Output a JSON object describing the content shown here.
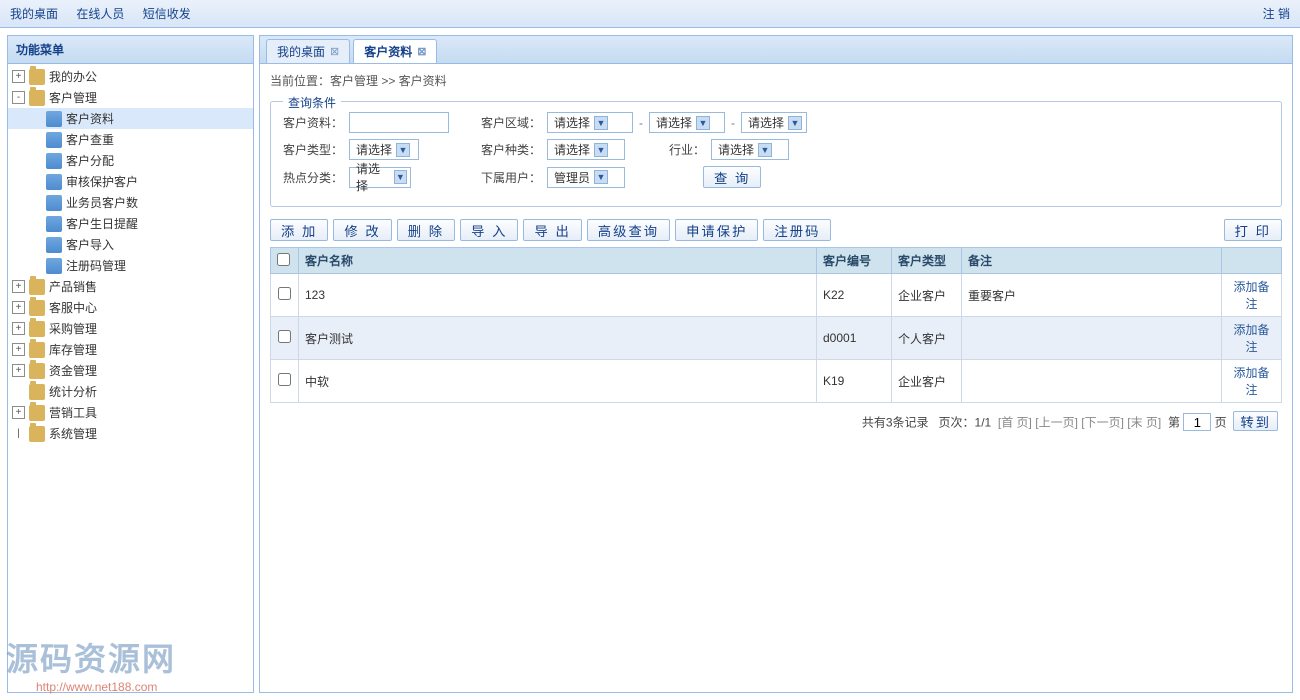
{
  "topbar": {
    "links": [
      "我的桌面",
      "在线人员",
      "短信收发"
    ],
    "logout": "注 销"
  },
  "sidebar": {
    "title": "功能菜单",
    "nodes": [
      {
        "label": "我的办公",
        "expand": "+",
        "level": 0
      },
      {
        "label": "客户管理",
        "expand": "-",
        "level": 0
      },
      {
        "label": "客户资料",
        "level": 1,
        "selected": true
      },
      {
        "label": "客户查重",
        "level": 1
      },
      {
        "label": "客户分配",
        "level": 1
      },
      {
        "label": "审核保护客户",
        "level": 1
      },
      {
        "label": "业务员客户数",
        "level": 1
      },
      {
        "label": "客户生日提醒",
        "level": 1
      },
      {
        "label": "客户导入",
        "level": 1
      },
      {
        "label": "注册码管理",
        "level": 1
      },
      {
        "label": "产品销售",
        "expand": "+",
        "level": 0
      },
      {
        "label": "客服中心",
        "expand": "+",
        "level": 0
      },
      {
        "label": "采购管理",
        "expand": "+",
        "level": 0
      },
      {
        "label": "库存管理",
        "expand": "+",
        "level": 0
      },
      {
        "label": "资金管理",
        "expand": "+",
        "level": 0
      },
      {
        "label": "统计分析",
        "expand": "",
        "level": 0,
        "noToggle": true
      },
      {
        "label": "营销工具",
        "expand": "+",
        "level": 0
      },
      {
        "label": "系统管理",
        "expand": "",
        "level": 0,
        "lastIcon": true
      }
    ]
  },
  "tabs": [
    {
      "label": "我的桌面",
      "active": false
    },
    {
      "label": "客户资料",
      "active": true
    }
  ],
  "breadcrumb": "当前位置：客户管理  >>  客户资料",
  "search": {
    "legend": "查询条件",
    "labels": {
      "customerData": "客户资料：",
      "customerArea": "客户区域：",
      "customerType": "客户类型：",
      "customerKind": "客户种类：",
      "industry": "行业：",
      "hotCategory": "热点分类：",
      "subUser": "下属用户："
    },
    "placeholders": {
      "select": "请选择",
      "admin": "管理员"
    },
    "queryBtn": "查 询"
  },
  "toolbar": {
    "add": "添 加",
    "edit": "修 改",
    "delete": "删 除",
    "import": "导 入",
    "export": "导 出",
    "advanced": "高级查询",
    "protect": "申请保护",
    "regcode": "注册码",
    "print": "打 印"
  },
  "table": {
    "headers": {
      "name": "客户名称",
      "code": "客户编号",
      "type": "客户类型",
      "note": "备注"
    },
    "rows": [
      {
        "name": "123",
        "code": "K22",
        "type": "企业客户",
        "note": "重要客户",
        "action": "添加备注"
      },
      {
        "name": "客户测试",
        "code": "d0001",
        "type": "个人客户",
        "note": "",
        "action": "添加备注"
      },
      {
        "name": "中软",
        "code": "K19",
        "type": "企业客户",
        "note": "",
        "action": "添加备注"
      }
    ]
  },
  "pager": {
    "total": "共有3条记录",
    "page": "页次：1/1",
    "first": "[首 页]",
    "prev": "[上一页]",
    "next": "[下一页]",
    "last": "[末 页]",
    "goPrefix": "第",
    "goSuffix": "页",
    "pageValue": "1",
    "goBtn": "转到"
  },
  "watermark": {
    "title": "源码资源网",
    "url": "http://www.net188.com"
  }
}
